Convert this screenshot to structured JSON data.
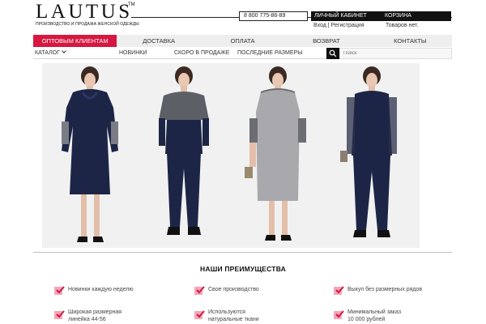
{
  "header": {
    "logo": "LAUTUS",
    "logo_tm": "TM",
    "tagline": "ПРОИЗВОДСТВО И ПРОДАЖА ЖЕНСКОЙ ОДЕЖДЫ",
    "phone": "8 800 775-86-89",
    "cabinet_label": "ЛИЧНЫЙ КАБИНЕТ",
    "cart_label": "КОРЗИНА",
    "login_label": "Вход",
    "separator": "|",
    "register_label": "Регистрация",
    "cart_status": "Товаров нет."
  },
  "main_nav": {
    "items": [
      {
        "label": "ОПТОВЫМ КЛИЕНТАМ",
        "active": true
      },
      {
        "label": "ДОСТАВКА",
        "active": false
      },
      {
        "label": "ОПЛАТА",
        "active": false
      },
      {
        "label": "ВОЗВРАТ",
        "active": false
      },
      {
        "label": "КОНТАКТЫ",
        "active": false
      }
    ]
  },
  "sub_nav": {
    "catalog_label": "КАТАЛОГ",
    "items": [
      "НОВИНКИ",
      "СКОРО В ПРОДАЖЕ",
      "ПОСЛЕДНИЕ РАЗМЕРЫ"
    ],
    "search_placeholder": "Поиск"
  },
  "advantages": {
    "title": "НАШИ ПРЕИМУЩЕСТВА",
    "items": [
      "Новинки каждую неделю",
      "Свое производство",
      "Выкуп без размерных рядов",
      "Широкая размерная линейка 44-56",
      "Используются натуральные ткани",
      "Минимальный заказ 10 000 рублей"
    ]
  },
  "colors": {
    "accent": "#d6173f",
    "check_bg": "#f3a7b8",
    "dark": "#111111"
  }
}
